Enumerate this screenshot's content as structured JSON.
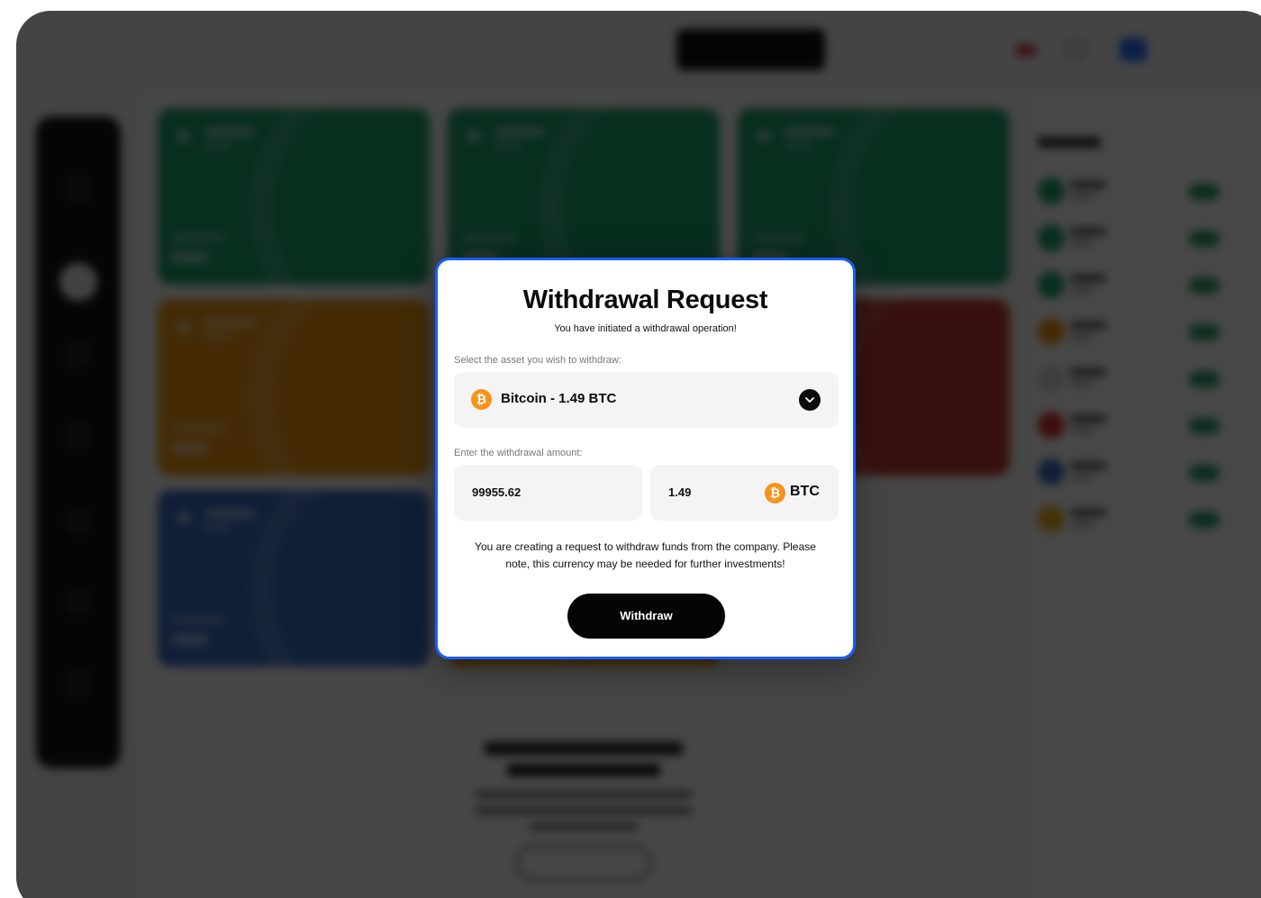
{
  "modal": {
    "title": "Withdrawal Request",
    "subtitle": "You have initiated a withdrawal operation!",
    "select_label": "Select the asset you wish to withdraw:",
    "selected_asset": "Bitcoin - 1.49 BTC",
    "coin_icon": "bitcoin-icon",
    "coin_symbol": "₿",
    "amount_label": "Enter the withdrawal amount:",
    "amount_usd": "99955.62",
    "amount_crypto": "1.49",
    "currency": "BTC",
    "note": "You are creating a request to withdraw funds from the company. Please note, this currency may be needed for further investments!",
    "withdraw_label": "Withdraw"
  },
  "colors": {
    "modal_border": "#1a5cff",
    "bitcoin": "#f7931a",
    "button": "#050505",
    "wallet_green": "#1fa56b",
    "wallet_orange": "#f39a16",
    "wallet_blue": "#3a6fc7",
    "wallet_red": "#c53b2f"
  }
}
